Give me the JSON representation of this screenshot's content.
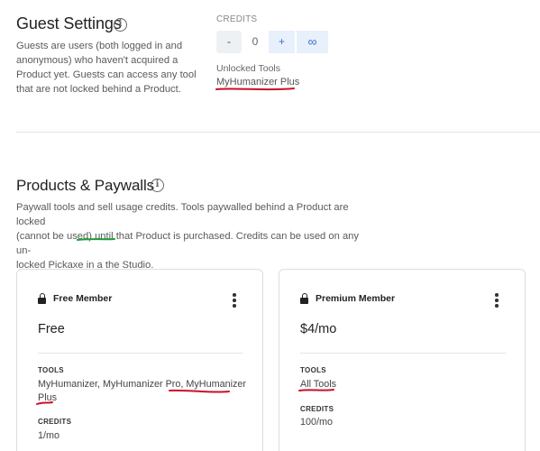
{
  "guest": {
    "title": "Guest Settings",
    "info_icon": "info-icon",
    "description": "Guests are users (both logged in and anonymous) who haven't acquired a Product yet. Guests can access any tool that are not locked behind a Product.",
    "description_lines": [
      "Guests are users (both logged in and",
      "anonymous) who haven't acquired a",
      "Product yet. Guests can access any tool",
      "that are not locked behind a Product."
    ],
    "credits_label": "CREDITS",
    "minus_label": "-",
    "credits_value": "0",
    "plus_label": "+",
    "infinity_label": "∞",
    "unlocked_label": "Unlocked Tools",
    "unlocked_tool": "MyHumanizer Plus"
  },
  "products": {
    "title": "Products & Paywalls",
    "info_icon": "info-icon",
    "description_lines": [
      "Paywall tools and sell usage credits. Tools paywalled behind a Product are locked",
      "(cannot be used) until that Product is purchased. Credits can be used on any un-",
      "locked Pickaxe in a the Studio."
    ],
    "cards": [
      {
        "title": "Free Member",
        "price": "Free",
        "tools_label": "TOOLS",
        "tools_lines": [
          "MyHumanizer, MyHumanizer Pro, MyHumanizer",
          "Plus"
        ],
        "credits_label": "CREDITS",
        "credits_value": "1/mo"
      },
      {
        "title": "Premium Member",
        "price": "$4/mo",
        "tools_label": "TOOLS",
        "tools_lines": [
          "All Tools"
        ],
        "credits_label": "CREDITS",
        "credits_value": "100/mo"
      }
    ]
  },
  "colors": {
    "annotation_red": "#c8102e",
    "annotation_green": "#1f9d3a",
    "accent_blue": "#3a6fd0"
  }
}
